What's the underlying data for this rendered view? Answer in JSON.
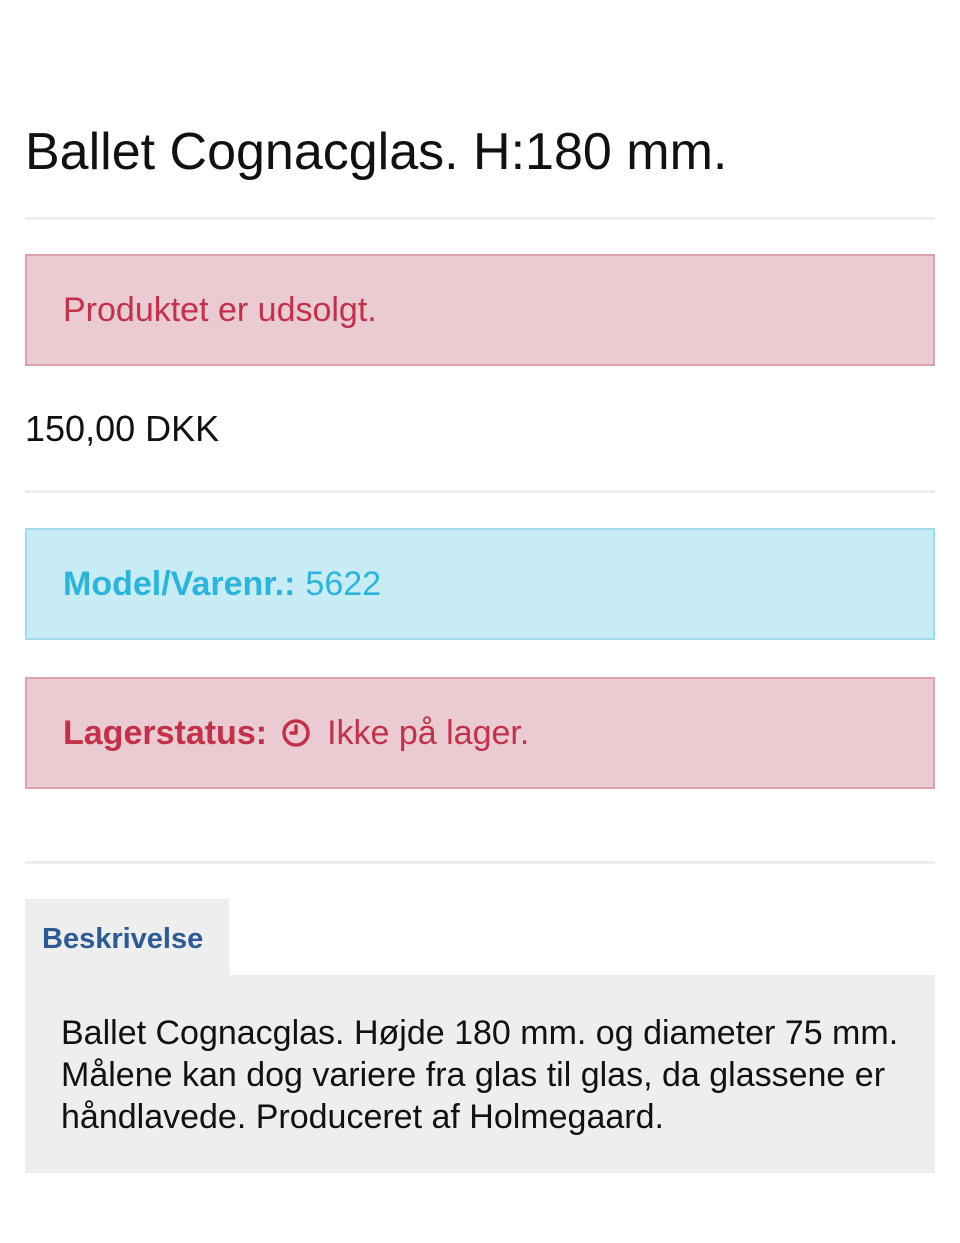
{
  "product": {
    "title": "Ballet Cognacglas. H:180 mm.",
    "sold_out_message": "Produktet er udsolgt.",
    "price": "150,00 DKK",
    "model_label": "Model/Varenr.:",
    "model_value": "5622",
    "stock_label": "Lagerstatus:",
    "stock_icon": "clock-icon",
    "stock_value": "Ikke på lager."
  },
  "tabs": {
    "description_label": "Beskrivelse",
    "description_text": "Ballet Cognacglas. Højde 180 mm. og diameter 75 mm. Målene kan dog variere fra glas til glas, da glassene er håndlavede. Produceret af Holmegaard."
  },
  "colors": {
    "danger_bg": "#eacbd1",
    "danger_text": "#c4304a",
    "info_bg": "#c8ecf4",
    "info_text": "#2bb5de",
    "tab_text": "#2c5a94"
  }
}
